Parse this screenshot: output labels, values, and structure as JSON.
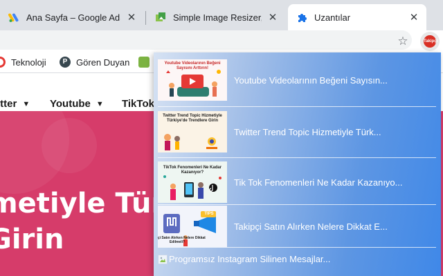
{
  "tabs": [
    {
      "title": "Ana Sayfa – Google AdSense",
      "close": "✕",
      "favicon": "adsense-icon",
      "active": false
    },
    {
      "title": "Simple Image Resizer, resize",
      "close": "✕",
      "favicon": "image-resizer-icon",
      "active": false
    },
    {
      "title": "Uzantılar",
      "close": "✕",
      "favicon": "puzzle-icon",
      "active": true
    }
  ],
  "toolbar": {
    "bookmark_icon": "☆",
    "extension_label": "Takipçi"
  },
  "bookmarks": [
    {
      "label": "Teknoloji",
      "icon": "target-icon"
    },
    {
      "label": "Gören Duyan",
      "icon": "p-circle-icon"
    },
    {
      "label": "",
      "icon": "leaf-icon"
    }
  ],
  "site_nav": [
    {
      "label": "itter",
      "chevron": "▼"
    },
    {
      "label": "Youtube",
      "chevron": "▼"
    },
    {
      "label": "TikTok",
      "chevron": ""
    }
  ],
  "hero": {
    "title": "metiyle Türk\nGirin"
  },
  "popup": {
    "posts": [
      {
        "title": "Youtube Videolarının Beğeni Sayısın...",
        "thumb_text": "Youtube Videolarının Beğeni Sayısını Arttırın!"
      },
      {
        "title": "Twitter Trend Topic Hizmetiyle Türk...",
        "thumb_text": "Twitter Trend Topic Hizmetiyle Türkiye'de Trendlere Girin"
      },
      {
        "title": "Tik Tok Fenomenleri Ne Kadar Kazanıyo...",
        "thumb_text": "TikTok Fenomenleri Ne Kadar Kazanıyor?"
      },
      {
        "title": "Takipçi Satın Alırken Nelere Dikkat E...",
        "thumb_text": "Takipçi Satın Alırken Nelere Dikkat Edilmeli?",
        "badge": "TIPS"
      }
    ],
    "last_post": {
      "title": "Programsız Instagram Silinen Mesajlar..."
    }
  },
  "colors": {
    "hero_bg": "#d63c6a",
    "popup_accent": "#3f88e8",
    "tabstrip": "#dee1e6"
  }
}
